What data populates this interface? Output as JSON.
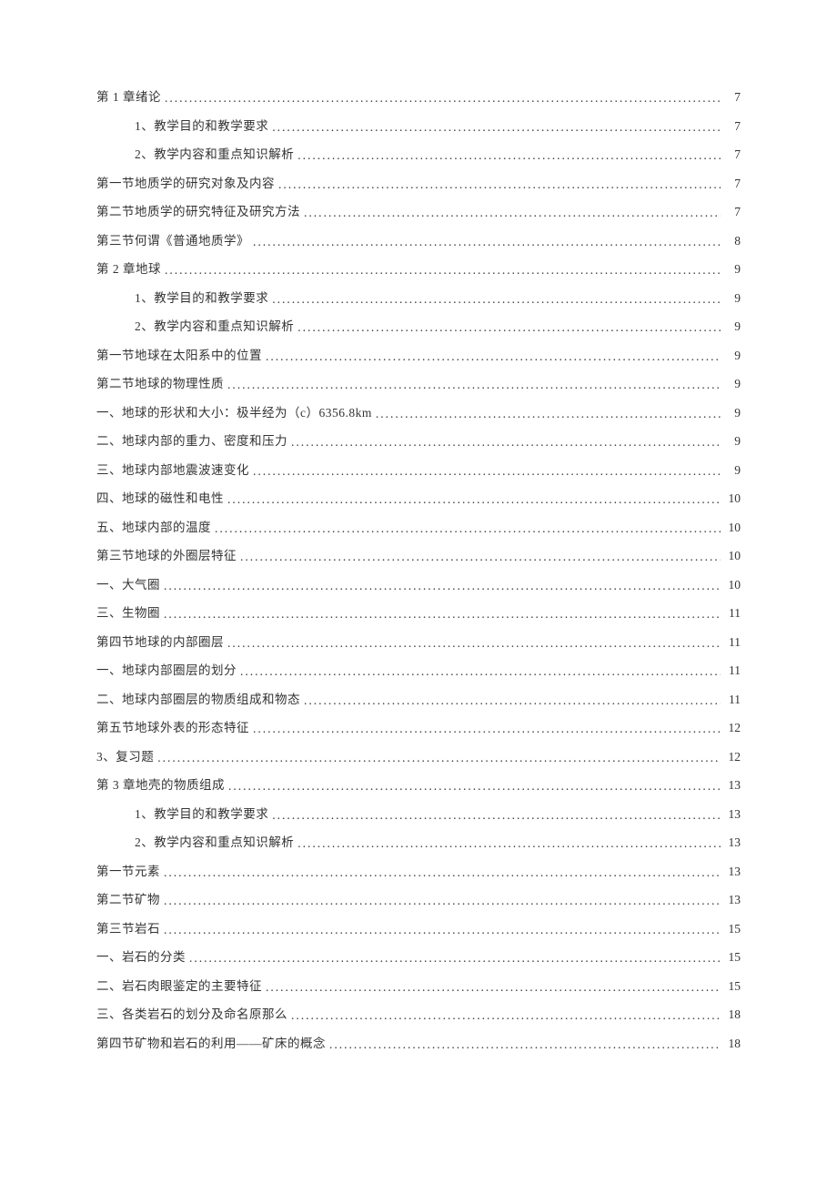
{
  "toc": [
    {
      "title": "第 1 章绪论",
      "page": "7",
      "indent": 0
    },
    {
      "title": "1、教学目的和教学要求",
      "page": "7",
      "indent": 1
    },
    {
      "title": "2、教学内容和重点知识解析",
      "page": "7",
      "indent": 1
    },
    {
      "title": "第一节地质学的研究对象及内容",
      "page": "7",
      "indent": 0
    },
    {
      "title": "第二节地质学的研究特征及研究方法",
      "page": "7",
      "indent": 0
    },
    {
      "title": "第三节何谓《普通地质学》",
      "page": "8",
      "indent": 0
    },
    {
      "title": "第 2 章地球",
      "page": "9",
      "indent": 0
    },
    {
      "title": "1、教学目的和教学要求",
      "page": "9",
      "indent": 1
    },
    {
      "title": "2、教学内容和重点知识解析",
      "page": "9",
      "indent": 1
    },
    {
      "title": "第一节地球在太阳系中的位置",
      "page": "9",
      "indent": 0
    },
    {
      "title": "第二节地球的物理性质",
      "page": "9",
      "indent": 0
    },
    {
      "title": "一、地球的形状和大小：极半经为（c）6356.8km",
      "page": "9",
      "indent": 0
    },
    {
      "title": "二、地球内部的重力、密度和压力",
      "page": "9",
      "indent": 0
    },
    {
      "title": "三、地球内部地震波速变化",
      "page": "9",
      "indent": 0
    },
    {
      "title": "四、地球的磁性和电性",
      "page": "10",
      "indent": 0
    },
    {
      "title": "五、地球内部的温度",
      "page": "10",
      "indent": 0
    },
    {
      "title": "第三节地球的外圈层特征",
      "page": "10",
      "indent": 0
    },
    {
      "title": "一、大气圈",
      "page": "10",
      "indent": 0
    },
    {
      "title": "三、生物圈",
      "page": "11",
      "indent": 0
    },
    {
      "title": "第四节地球的内部圈层",
      "page": "11",
      "indent": 0
    },
    {
      "title": "一、地球内部圈层的划分",
      "page": "11",
      "indent": 0
    },
    {
      "title": "二、地球内部圈层的物质组成和物态",
      "page": "11",
      "indent": 0
    },
    {
      "title": "第五节地球外表的形态特征",
      "page": "12",
      "indent": 0
    },
    {
      "title": "3、复习题",
      "page": "12",
      "indent": 0
    },
    {
      "title": "第 3 章地壳的物质组成",
      "page": "13",
      "indent": 0
    },
    {
      "title": "1、教学目的和教学要求",
      "page": "13",
      "indent": 1
    },
    {
      "title": "2、教学内容和重点知识解析",
      "page": "13",
      "indent": 1
    },
    {
      "title": "第一节元素",
      "page": "13",
      "indent": 0
    },
    {
      "title": "第二节矿物",
      "page": "13",
      "indent": 0
    },
    {
      "title": "第三节岩石",
      "page": "15",
      "indent": 0
    },
    {
      "title": "一、岩石的分类",
      "page": "15",
      "indent": 0
    },
    {
      "title": "二、岩石肉眼鉴定的主要特征",
      "page": "15",
      "indent": 0
    },
    {
      "title": "三、各类岩石的划分及命名原那么",
      "page": "18",
      "indent": 0
    },
    {
      "title": "第四节矿物和岩石的利用——矿床的概念",
      "page": "18",
      "indent": 0
    }
  ]
}
